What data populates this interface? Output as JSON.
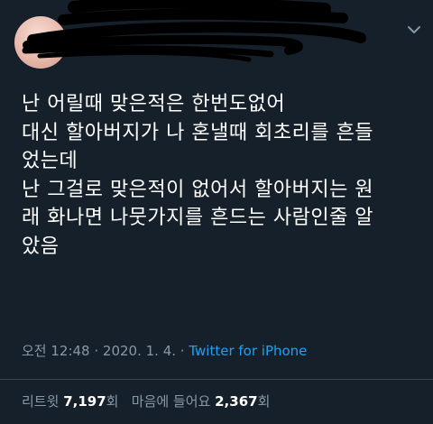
{
  "tweet": {
    "lines": [
      "난 어릴때 맞은적은 한번도없어",
      "대신 할아버지가 나 혼낼때 회초리를 흔들",
      "었는데",
      "난 그걸로 맞은적이 없어서 할아버지는 원",
      "래 화나면 나뭇가지를 흔드는 사람인줄 알",
      "았음"
    ]
  },
  "meta": {
    "time": "오전 12:48",
    "separator1": " · ",
    "date": "2020. 1. 4.",
    "separator2": " · ",
    "source": "Twitter for iPhone"
  },
  "stats": {
    "retweet_label": "리트윗",
    "retweet_count": "7,197",
    "retweet_unit": "회",
    "like_label": "마음에 들어요",
    "like_count": "2,367",
    "like_unit": "회"
  },
  "icons": {
    "menu": "chevron-down-icon"
  }
}
